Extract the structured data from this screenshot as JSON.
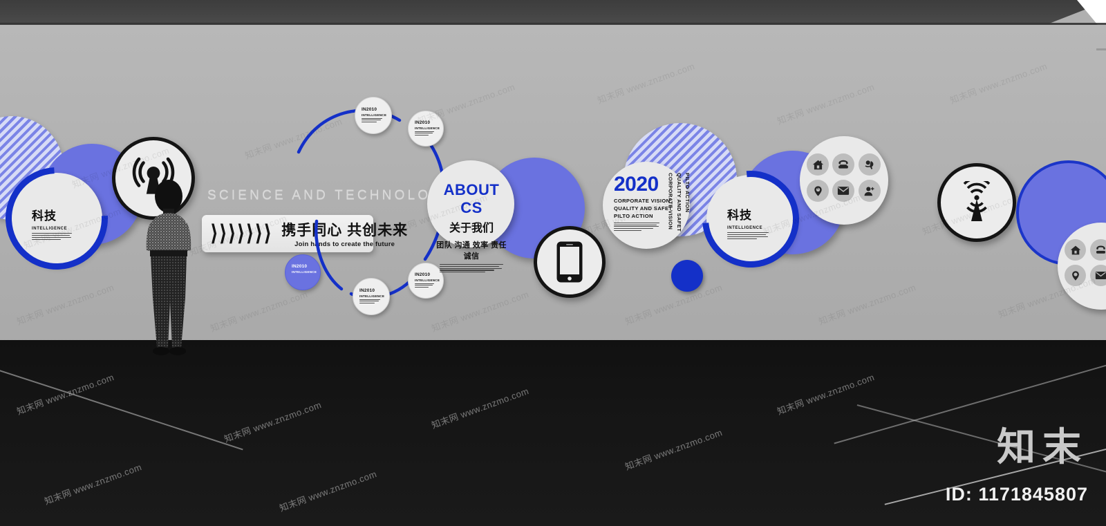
{
  "scene": {
    "type": "3d-interior-render",
    "subject": "corporate-culture-wall",
    "colors": {
      "wall": "#b4b4b4",
      "floor": "#141414",
      "ceiling": "#434343",
      "accent_blue": "#1430c8",
      "periwinkle": "#6a72e0",
      "plate_grey": "#e9e9e9"
    }
  },
  "headline": {
    "text": "SCIENCE AND TECHNOLOGY"
  },
  "banner": {
    "chevrons": "〉〉〉〉〉〉〉",
    "cn": "携手同心 共创未来",
    "en": "Join hands to create the future"
  },
  "tech_left": {
    "cn": "科技",
    "en": "INTELLIGENCE"
  },
  "tech_right": {
    "cn": "科技",
    "en": "INTELLIGENCE"
  },
  "about": {
    "title": "ABOUT CS",
    "cn": "关于我们",
    "tags": "团队 沟通 效率 责任 诚信"
  },
  "vision": {
    "year": "2020",
    "lines": [
      "CORPORATE VISION",
      "QUALITY AND SAFET",
      "PILTO ACTION"
    ],
    "vertical": [
      "CORPORATE VISION",
      "QUALITY AND SAFET",
      "PILTO ACTION"
    ]
  },
  "badges": [
    {
      "id": "b1",
      "title": "IN2010",
      "sub": "INTELLIGENCE",
      "style": "light"
    },
    {
      "id": "b2",
      "title": "IN2010",
      "sub": "INTELLIGENCE",
      "style": "light"
    },
    {
      "id": "b3",
      "title": "IN2010",
      "sub": "INTELLIGENCE",
      "style": "blue"
    },
    {
      "id": "b4",
      "title": "IN2010",
      "sub": "INTELLIGENCE",
      "style": "light"
    },
    {
      "id": "b5",
      "title": "IN2010",
      "sub": "INTELLIGENCE",
      "style": "light"
    }
  ],
  "icons": {
    "broadcast_left": "broadcast-tower-icon",
    "broadcast_right": "radio-signal-icon",
    "device": "smartphone-icon",
    "contact_grid": [
      "home-icon",
      "telephone-icon",
      "headset-support-icon",
      "location-pin-icon",
      "envelope-icon",
      "user-profile-icon"
    ]
  },
  "watermark": {
    "text": "知末网 www.znzmo.com",
    "brand": "知末",
    "id_label": "ID: 1171845807"
  }
}
